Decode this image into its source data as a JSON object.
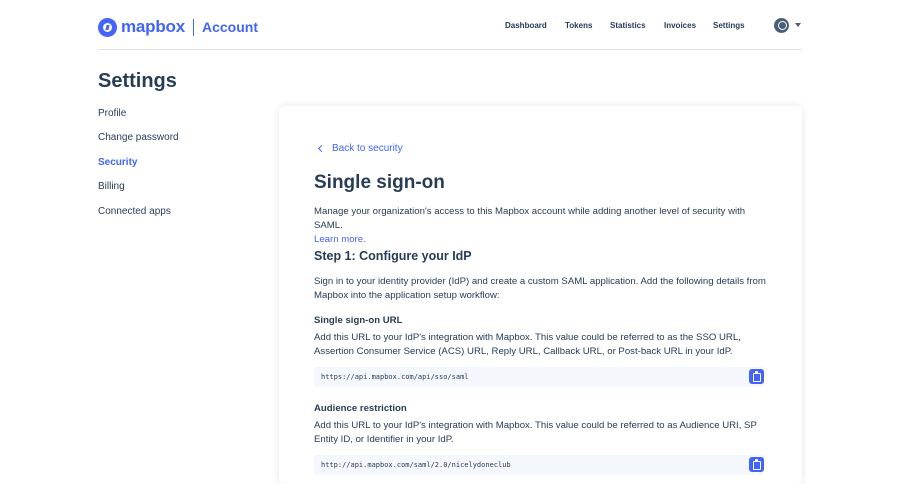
{
  "header": {
    "brand_name": "mapbox",
    "brand_product": "Account",
    "nav": [
      {
        "label": "Dashboard"
      },
      {
        "label": "Tokens"
      },
      {
        "label": "Statistics"
      },
      {
        "label": "Invoices"
      },
      {
        "label": "Settings"
      }
    ],
    "avatar_icon": "user-avatar-icon"
  },
  "sidebar": {
    "title": "Settings",
    "items": [
      {
        "label": "Profile",
        "active": false
      },
      {
        "label": "Change password",
        "active": false
      },
      {
        "label": "Security",
        "active": true
      },
      {
        "label": "Billing",
        "active": false
      },
      {
        "label": "Connected apps",
        "active": false
      }
    ]
  },
  "main": {
    "back_label": "Back to security",
    "title": "Single sign-on",
    "intro": "Manage your organization's access to this Mapbox account while adding another level of security with SAML.",
    "learn_more": "Learn more.",
    "step_title": "Step 1: Configure your IdP",
    "step_desc": "Sign in to your identity provider (IdP) and create a custom SAML application. Add the following details from Mapbox into the application setup workflow:",
    "sso": {
      "title": "Single sign-on URL",
      "desc": "Add this URL to your IdP's integration with Mapbox. This value could be referred to as the SSO URL, Assertion Consumer Service (ACS) URL, Reply URL, Callback URL, or Post-back URL in your IdP.",
      "value": "https://api.mapbox.com/api/sso/saml"
    },
    "audience": {
      "title": "Audience restriction",
      "desc": "Add this URL to your IdP's integration with Mapbox. This value could be referred to as Audience URI, SP Entity ID, or Identifier in your IdP.",
      "value": "http://api.mapbox.com/saml/2.0/nicelydoneclub"
    }
  },
  "colors": {
    "accent": "#4264fb",
    "text": "#273d56",
    "code_bg": "#f4f7fb"
  }
}
